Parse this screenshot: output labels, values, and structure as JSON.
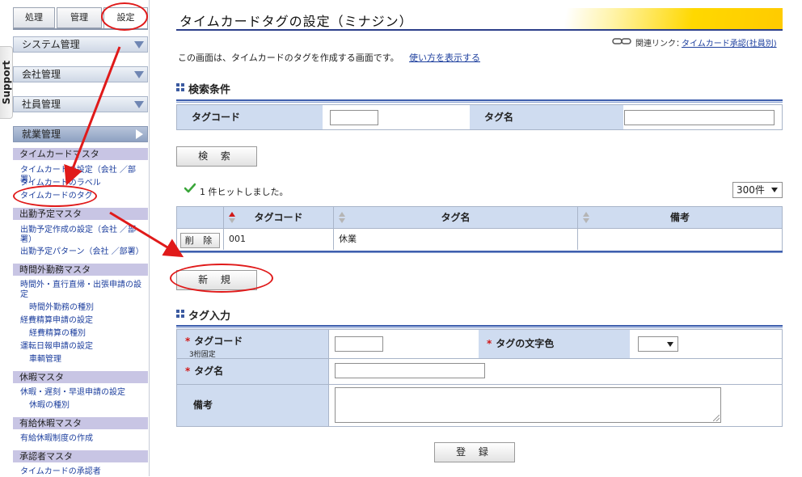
{
  "sidebar": {
    "tabs": [
      "処理",
      "管理",
      "設定"
    ],
    "support_label": "Support",
    "menus": [
      "システム管理",
      "会社管理",
      "社員管理",
      "就業管理"
    ],
    "sections": [
      {
        "title": "タイムカードマスタ",
        "links": [
          {
            "label": "タイムカードの設定（会社 ／部署）"
          },
          {
            "label": "タイムカードのラベル"
          },
          {
            "label": "タイムカードのタグ"
          }
        ]
      },
      {
        "title": "出勤予定マスタ",
        "links": [
          {
            "label": "出勤予定作成の設定（会社 ／部署）"
          },
          {
            "label": "出勤予定パターン（会社 ／部署）"
          }
        ]
      },
      {
        "title": "時間外勤務マスタ",
        "links": [
          {
            "label": "時間外・直行直帰・出張申請の設定"
          },
          {
            "label": "時間外勤務の種別"
          },
          {
            "label": "経費精算申請の設定"
          },
          {
            "label": "経費精算の種別"
          },
          {
            "label": "運転日報申請の設定"
          },
          {
            "label": "車輌管理"
          }
        ]
      },
      {
        "title": "休暇マスタ",
        "links": [
          {
            "label": "休暇・遅刻・早退申請の設定"
          },
          {
            "label": "休暇の種別"
          }
        ]
      },
      {
        "title": "有給休暇マスタ",
        "links": [
          {
            "label": "有給休暇制度の作成"
          }
        ]
      },
      {
        "title": "承認者マスタ",
        "links": [
          {
            "label": "タイムカードの承認者"
          }
        ]
      }
    ]
  },
  "header": {
    "title": "タイムカードタグの設定（ミナジン）",
    "related_label": "関連リンク：",
    "related_link": "タイムカード承認(社員別)"
  },
  "description": "この画面は、タイムカードのタグを作成する画面です。",
  "usage_link": "使い方を表示する",
  "search": {
    "section_title": "検索条件",
    "tag_code_label": "タグコード",
    "tag_name_label": "タグ名",
    "tag_code_value": "",
    "tag_name_value": "",
    "button": "検 索"
  },
  "results": {
    "hit_text": "1 件ヒットしました。",
    "per_page": "300件",
    "columns": [
      "タグコード",
      "タグ名",
      "備考"
    ],
    "rows": [
      {
        "delete_label": "削 除",
        "code": "001",
        "name": "休業",
        "remarks": ""
      }
    ]
  },
  "new_button": "新 規",
  "tag_input": {
    "section_title": "タグ入力",
    "code_label": "タグコード",
    "code_hint": "3桁固定",
    "color_label": "タグの文字色",
    "name_label": "タグ名",
    "remarks_label": "備考",
    "required_mark": "*",
    "code_value": "",
    "name_value": "",
    "remarks_value": "",
    "color_value": ""
  },
  "register_button": "登 録",
  "colors": {
    "accent_blue": "#3f5fae",
    "label_bg": "#cfdcf0",
    "link": "#1d3f9e",
    "annotation_red": "#e01a1a",
    "title_gradient": "#ffd800"
  }
}
